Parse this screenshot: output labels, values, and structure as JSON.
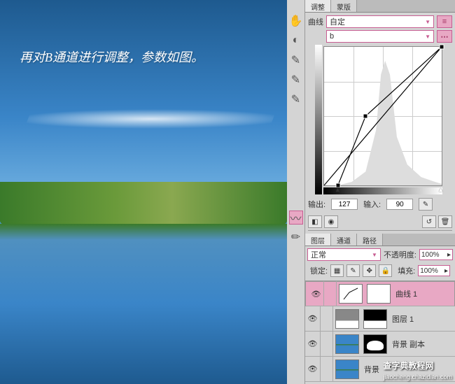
{
  "tabs_top": {
    "adjust": "调整",
    "mask": "蒙版"
  },
  "curves": {
    "title": "曲线",
    "preset": "自定",
    "channel": "b",
    "output_label": "输出:",
    "output_value": "127",
    "input_label": "输入:",
    "input_value": "90"
  },
  "layers_tabs": {
    "layers": "图层",
    "channels": "通道",
    "paths": "路径"
  },
  "layers_top": {
    "blend": "正常",
    "opacity_label": "不透明度:",
    "opacity_value": "100%",
    "lock_label": "锁定:",
    "fill_label": "填充:",
    "fill_value": "100%"
  },
  "layers": [
    {
      "name": "曲线 1",
      "type": "adjust"
    },
    {
      "name": "图层 1",
      "type": "gray"
    },
    {
      "name": "背景 副本",
      "type": "land"
    },
    {
      "name": "背景",
      "type": "land2"
    }
  ],
  "overlay": "再对B通道进行调整，参数如图。",
  "watermark": "查字典教程网",
  "watermark_url": "jiaocheng.chazidian.com",
  "chart_data": {
    "type": "line",
    "title": "Curves - channel b",
    "xlabel": "Input",
    "ylabel": "Output",
    "xlim": [
      0,
      255
    ],
    "ylim": [
      0,
      255
    ],
    "points": [
      {
        "x": 30,
        "y": 0
      },
      {
        "x": 90,
        "y": 127
      },
      {
        "x": 255,
        "y": 255
      }
    ],
    "diagonal": [
      [
        0,
        0
      ],
      [
        255,
        255
      ]
    ]
  }
}
